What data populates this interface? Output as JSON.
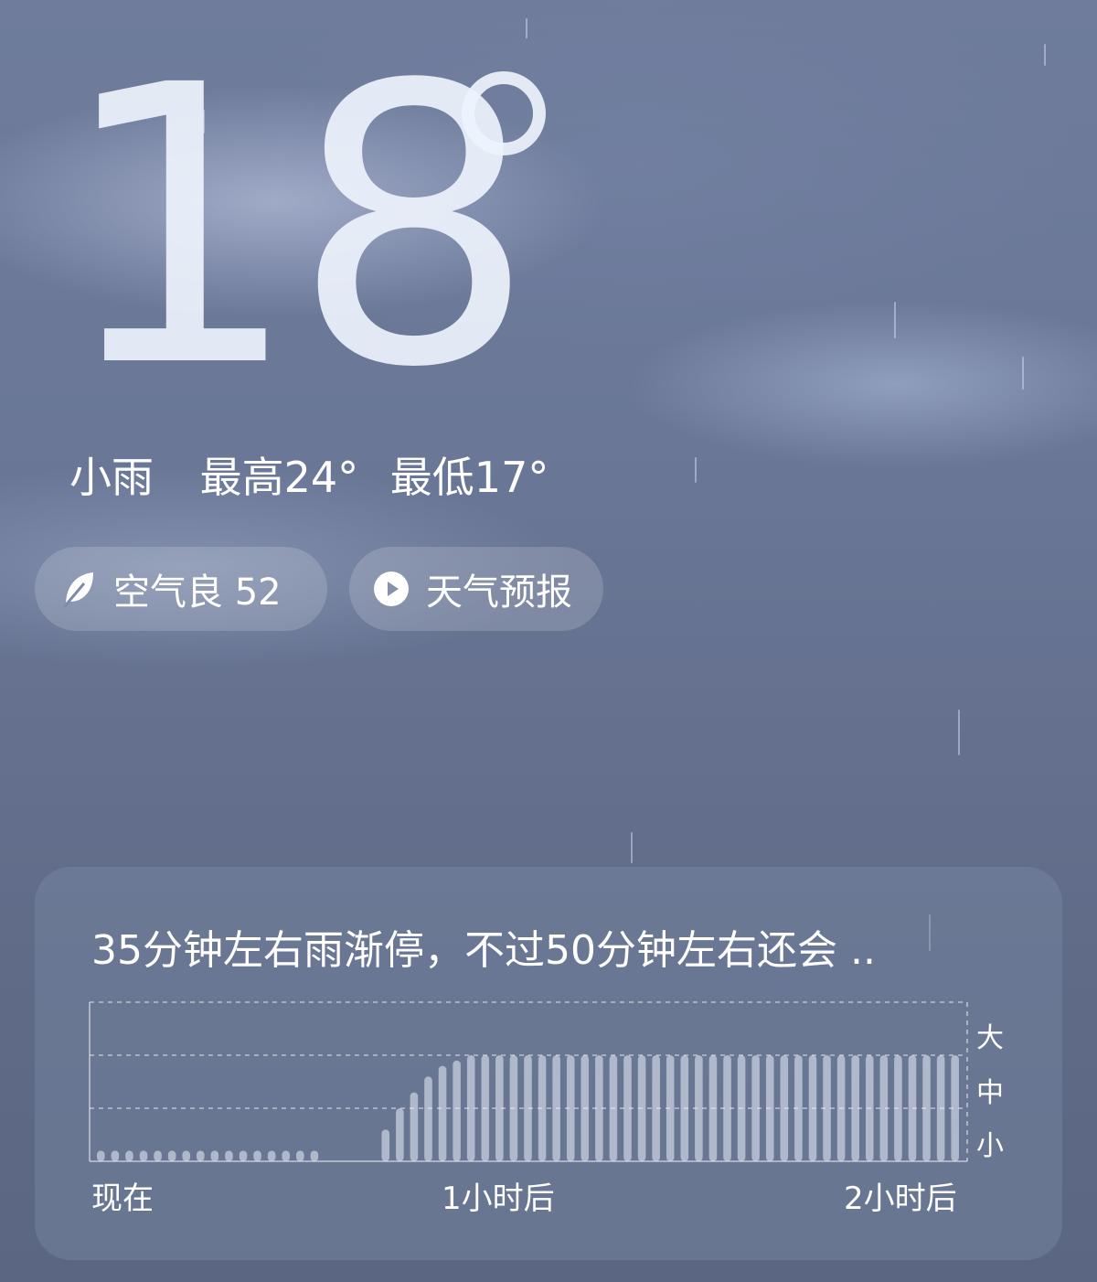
{
  "current": {
    "temperature": "18",
    "condition": "小雨",
    "high": "最高24°",
    "low": "最低17°"
  },
  "pills": {
    "air_quality": "空气良 52",
    "forecast": "天气预报"
  },
  "precip_card": {
    "summary": "35分钟左右雨渐停，不过50分钟左右还会 ..",
    "y_levels": [
      "大",
      "中",
      "小"
    ],
    "x_labels": [
      "现在",
      "1小时后",
      "2小时后"
    ]
  },
  "chart_data": {
    "type": "bar",
    "title": "35分钟左右雨渐停，不过50分钟左右还会 ..",
    "x_tick_labels": [
      "现在",
      "1小时后",
      "2小时后"
    ],
    "y_tick_labels": [
      "小",
      "中",
      "大"
    ],
    "ylim": [
      0,
      3
    ],
    "grid": true,
    "values": [
      0.2,
      0.2,
      0.2,
      0.2,
      0.2,
      0.2,
      0.2,
      0.2,
      0.2,
      0.2,
      0.2,
      0.2,
      0.2,
      0.2,
      0.2,
      0.2,
      0,
      0,
      0,
      0,
      0.6,
      1.0,
      1.3,
      1.6,
      1.8,
      1.9,
      2.0,
      2.0,
      2.0,
      2.0,
      2.0,
      2.0,
      2.0,
      2.0,
      2.0,
      2.0,
      2.0,
      2.0,
      2.0,
      2.0,
      2.0,
      2.0,
      2.0,
      2.0,
      2.0,
      2.0,
      2.0,
      2.0,
      2.0,
      2.0,
      2.0,
      2.0,
      2.0,
      2.0,
      2.0,
      2.0,
      2.0,
      2.0,
      2.0,
      2.0,
      2.0
    ]
  }
}
